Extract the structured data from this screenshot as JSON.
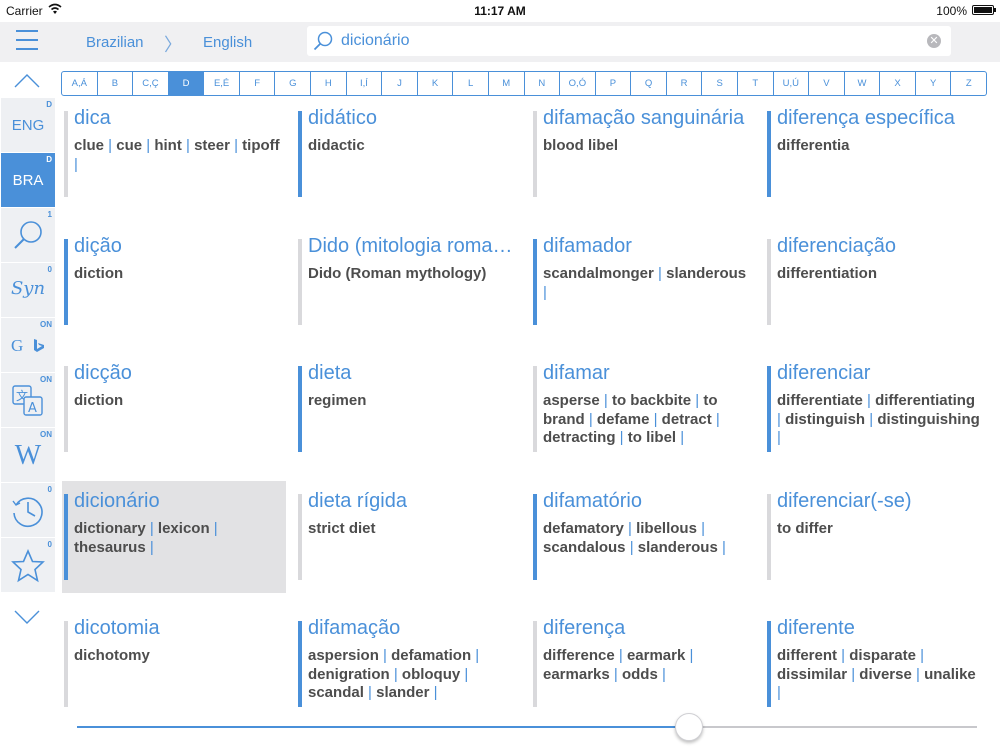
{
  "status": {
    "carrier": "Carrier",
    "time": "11:17 AM",
    "battery": "100%"
  },
  "header": {
    "from_lang": "Brazilian",
    "separator": "〉",
    "to_lang": "English"
  },
  "search": {
    "value": "dicionário",
    "clear": "✕"
  },
  "alphabet": {
    "letters": [
      "A,Á",
      "B",
      "C,Ç",
      "D",
      "E,É",
      "F",
      "G",
      "H",
      "I,Í",
      "J",
      "K",
      "L",
      "M",
      "N",
      "O,Ó",
      "P",
      "Q",
      "R",
      "S",
      "T",
      "U,Ú",
      "V",
      "W",
      "X",
      "Y",
      "Z"
    ],
    "active_index": 3
  },
  "sidebar": {
    "items": [
      {
        "label": "ENG",
        "badge": "D",
        "active": false
      },
      {
        "label": "BRA",
        "badge": "D",
        "active": true
      },
      {
        "icon": "search-icon",
        "badge": "1"
      },
      {
        "label": "Syn",
        "badge": "0"
      },
      {
        "label": "G",
        "icon": "bing-icon",
        "badge": "ON"
      },
      {
        "icon": "translate-icon",
        "badge": "ON"
      },
      {
        "label": "W",
        "badge": "ON"
      },
      {
        "icon": "history-clock-icon",
        "badge": "0"
      },
      {
        "icon": "star-icon",
        "badge": "0"
      }
    ]
  },
  "entries": [
    {
      "headword": "dica",
      "translation": [
        "clue",
        "cue",
        "hint",
        "steer",
        "tipoff"
      ],
      "bar": "grey"
    },
    {
      "headword": "didático",
      "translation": [
        "didactic"
      ],
      "bar": "blue"
    },
    {
      "headword": "difamação sanguinária",
      "translation": [
        "blood libel"
      ],
      "bar": "grey"
    },
    {
      "headword": "diferença específica",
      "translation": [
        "differentia"
      ],
      "bar": "blue"
    },
    {
      "headword": "dição",
      "translation": [
        "diction"
      ],
      "bar": "blue"
    },
    {
      "headword": "Dido (mitologia romana)",
      "translation": [
        "Dido (Roman mythology)"
      ],
      "bar": "grey"
    },
    {
      "headword": "difamador",
      "translation": [
        "scandalmonger",
        "slanderous"
      ],
      "bar": "blue"
    },
    {
      "headword": "diferenciação",
      "translation": [
        "differentiation"
      ],
      "bar": "grey"
    },
    {
      "headword": "dicção",
      "translation": [
        "diction"
      ],
      "bar": "grey"
    },
    {
      "headword": "dieta",
      "translation": [
        "regimen"
      ],
      "bar": "blue"
    },
    {
      "headword": "difamar",
      "translation": [
        "asperse",
        "to backbite",
        "to brand",
        "defame",
        "detract",
        "detracting",
        "to libel"
      ],
      "bar": "grey"
    },
    {
      "headword": "diferenciar",
      "translation": [
        "differentiate",
        "differentiating",
        "distinguish",
        "distinguishing"
      ],
      "bar": "blue"
    },
    {
      "headword": "dicionário",
      "translation": [
        "dictionary",
        "lexicon",
        "thesaurus"
      ],
      "bar": "blue",
      "selected": true
    },
    {
      "headword": "dieta rígida",
      "translation": [
        "strict diet"
      ],
      "bar": "grey"
    },
    {
      "headword": "difamatório",
      "translation": [
        "defamatory",
        "libellous",
        "scandalous",
        "slanderous"
      ],
      "bar": "blue"
    },
    {
      "headword": "diferenciar(-se)",
      "translation": [
        "to differ"
      ],
      "bar": "grey"
    },
    {
      "headword": "dicotomia",
      "translation": [
        "dichotomy"
      ],
      "bar": "grey"
    },
    {
      "headword": "difamação",
      "translation": [
        "aspersion",
        "defamation",
        "denigration",
        "obloquy",
        "scandal",
        "slander"
      ],
      "bar": "blue"
    },
    {
      "headword": "diferença",
      "translation": [
        "difference",
        "earmark",
        "earmarks",
        "odds"
      ],
      "bar": "grey"
    },
    {
      "headword": "diferente",
      "translation": [
        "different",
        "disparate",
        "dissimilar",
        "diverse",
        "unalike"
      ],
      "bar": "blue"
    }
  ],
  "slider": {
    "value": 0.68
  },
  "colors": {
    "accent": "#4a90d9",
    "bar_grey": "#d9d9dc",
    "selected_bg": "#e2e2e4"
  }
}
